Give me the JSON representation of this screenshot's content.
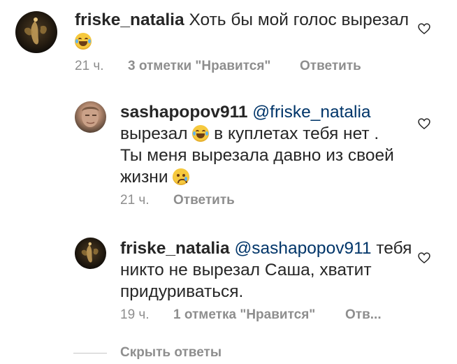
{
  "comments": [
    {
      "username": "friske_natalia",
      "text": "Хоть бы мой голос вырезал",
      "time": "21 ч.",
      "likes": "3 отметки \"Нравится\"",
      "reply": "Ответить"
    },
    {
      "username": "sashapopov911",
      "mention": "@friske_natalia",
      "text_part1": "вырезал",
      "text_part2": "в куплетах тебя нет .",
      "text_line2": "Ты меня вырезала давно из своей",
      "text_line3": "жизни",
      "time": "21 ч.",
      "reply": "Ответить"
    },
    {
      "username": "friske_natalia",
      "mention": "@sashapopov911",
      "text_part1": "тебя",
      "text_line2": "никто не вырезал Саша, хватит",
      "text_line3": "придуриваться.",
      "time": "19 ч.",
      "likes": "1 отметка \"Нравится\"",
      "reply": "Отв..."
    }
  ],
  "hide_replies": "Скрыть ответы",
  "icons": {
    "like": "heart-outline-icon",
    "laugh_emoji": "face-with-tears-of-joy-emoji",
    "sad_emoji": "crying-face-emoji"
  },
  "colors": {
    "text": "#262626",
    "meta": "#8e8e8e",
    "mention": "#003569"
  }
}
